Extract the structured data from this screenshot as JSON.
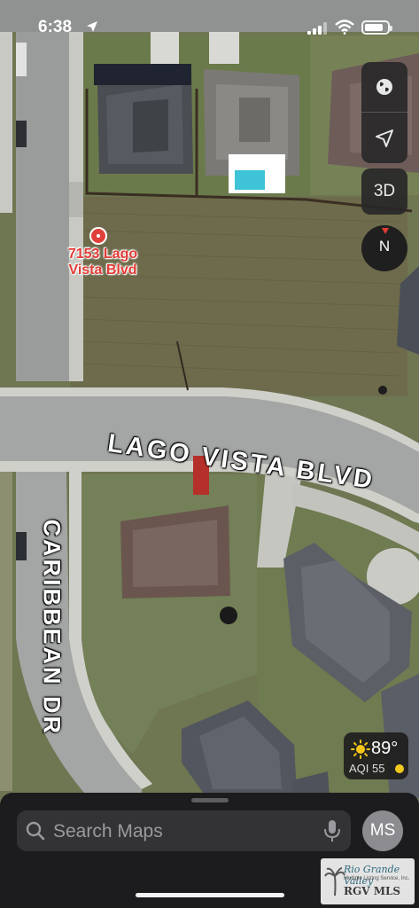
{
  "status_bar": {
    "time": "6:38",
    "battery_level": 0.82,
    "icons": [
      "location-arrow-icon",
      "cellular-signal-icon",
      "wifi-icon",
      "battery-icon"
    ]
  },
  "map": {
    "type": "satellite",
    "pin": {
      "label": "7153 Lago Vista Blvd",
      "color": "#e23b36"
    },
    "road_labels": [
      "LAGO VISTA BLVD",
      "CARIBBEAN DR"
    ]
  },
  "controls": {
    "globe_icon": "globe-icon",
    "location_icon": "location-arrow-icon",
    "view_3d_label": "3D",
    "compass_label": "N"
  },
  "weather": {
    "temperature": "89°",
    "aqi": "AQI 55",
    "aqi_color": "#f3c81e",
    "icon": "sun-icon"
  },
  "bottom_sheet": {
    "search_placeholder": "Search Maps",
    "avatar_initials": "MS"
  },
  "watermark": {
    "line1": "Rio Grande Valley",
    "line2": "Multiple Listing Service, Inc.",
    "line3": "RGV MLS"
  }
}
